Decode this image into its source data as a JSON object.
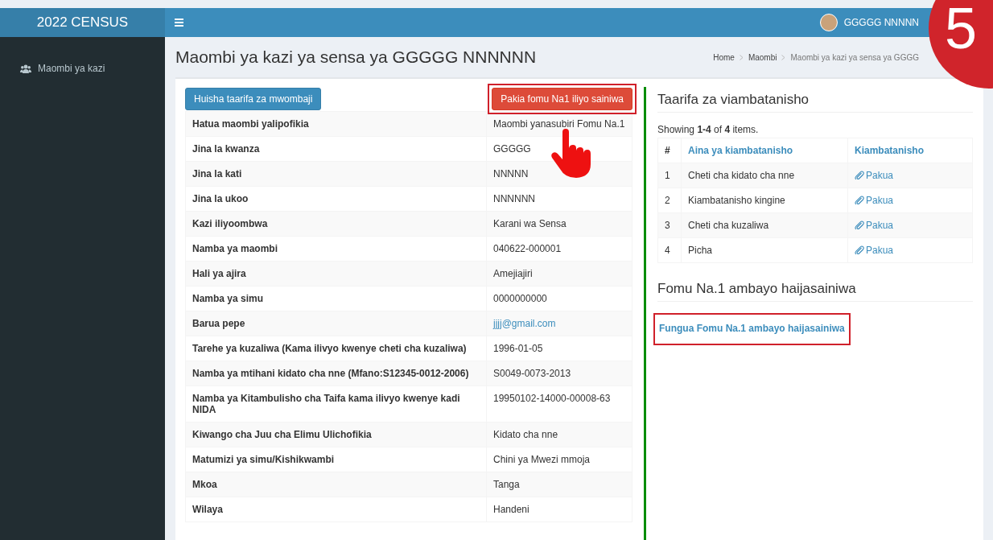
{
  "brand": "2022 CENSUS",
  "user": {
    "name": "GGGGG NNNNN"
  },
  "sidebar": {
    "items": [
      {
        "label": "Maombi ya kazi",
        "selected": false
      }
    ]
  },
  "page": {
    "title": "Maombi ya kazi ya sensa ya GGGGG NNNNNN",
    "breadcrumb": [
      "Home",
      "Maombi",
      "Maombi ya kazi ya sensa ya GGGG"
    ]
  },
  "actions": [
    {
      "label": "Huisha taarifa za mwombaji",
      "kind": "primary",
      "highlighted": false
    },
    {
      "label": "Pakia fomu Na1 iliyo sainiwa",
      "kind": "danger",
      "highlighted": true
    }
  ],
  "details": [
    {
      "label": "Hatua maombi yalipofikia",
      "value": "Maombi yanasubiri Fomu Na.1"
    },
    {
      "label": "Jina la kwanza",
      "value": "GGGGG"
    },
    {
      "label": "Jina la kati",
      "value": "NNNNN"
    },
    {
      "label": "Jina la ukoo",
      "value": "NNNNNN"
    },
    {
      "label": "Kazi iliyoombwa",
      "value": "Karani wa Sensa"
    },
    {
      "label": "Namba ya maombi",
      "value": "040622-000001"
    },
    {
      "label": "Hali ya ajira",
      "value": "Amejiajiri"
    },
    {
      "label": "Namba ya simu",
      "value": "0000000000"
    },
    {
      "label": "Barua pepe",
      "value": "jjjj@gmail.com",
      "kind": "link"
    },
    {
      "label": "Tarehe ya kuzaliwa (Kama ilivyo kwenye cheti cha kuzaliwa)",
      "value": "1996-01-05"
    },
    {
      "label": "Namba ya mtihani kidato cha nne (Mfano:S12345-0012-2006)",
      "value": "S0049-0073-2013"
    },
    {
      "label": "Namba ya Kitambulisho cha Taifa kama ilivyo kwenye kadi NIDA",
      "value": "19950102-14000-00008-63"
    },
    {
      "label": "Kiwango cha Juu cha Elimu Ulichofikia",
      "value": "Kidato cha nne"
    },
    {
      "label": "Matumizi ya simu/Kishikwambi",
      "value": "Chini ya Mwezi mmoja"
    },
    {
      "label": "Mkoa",
      "value": "Tanga"
    },
    {
      "label": "Wilaya",
      "value": "Handeni"
    }
  ],
  "attachments": {
    "title": "Taarifa za viambatanisho",
    "summary": "Showing **1-4** of **4** items.",
    "columns": [
      "#",
      "Aina ya kiambatanisho",
      "Kiambatanisho"
    ],
    "rows": [
      {
        "index": "1",
        "type": "Cheti cha kidato cha nne",
        "link": "Pakua"
      },
      {
        "index": "2",
        "type": "Kiambatanisho kingine",
        "link": "Pakua"
      },
      {
        "index": "3",
        "type": "Cheti cha kuzaliwa",
        "link": "Pakua"
      },
      {
        "index": "4",
        "type": "Picha",
        "link": "Pakua"
      }
    ]
  },
  "unsigned_form": {
    "title": "Fomu Na.1 ambayo haijasainiwa",
    "link": "Fungua Fomu Na.1 ambayo haijasainiwa",
    "highlighted": true
  },
  "step_badge": "5"
}
